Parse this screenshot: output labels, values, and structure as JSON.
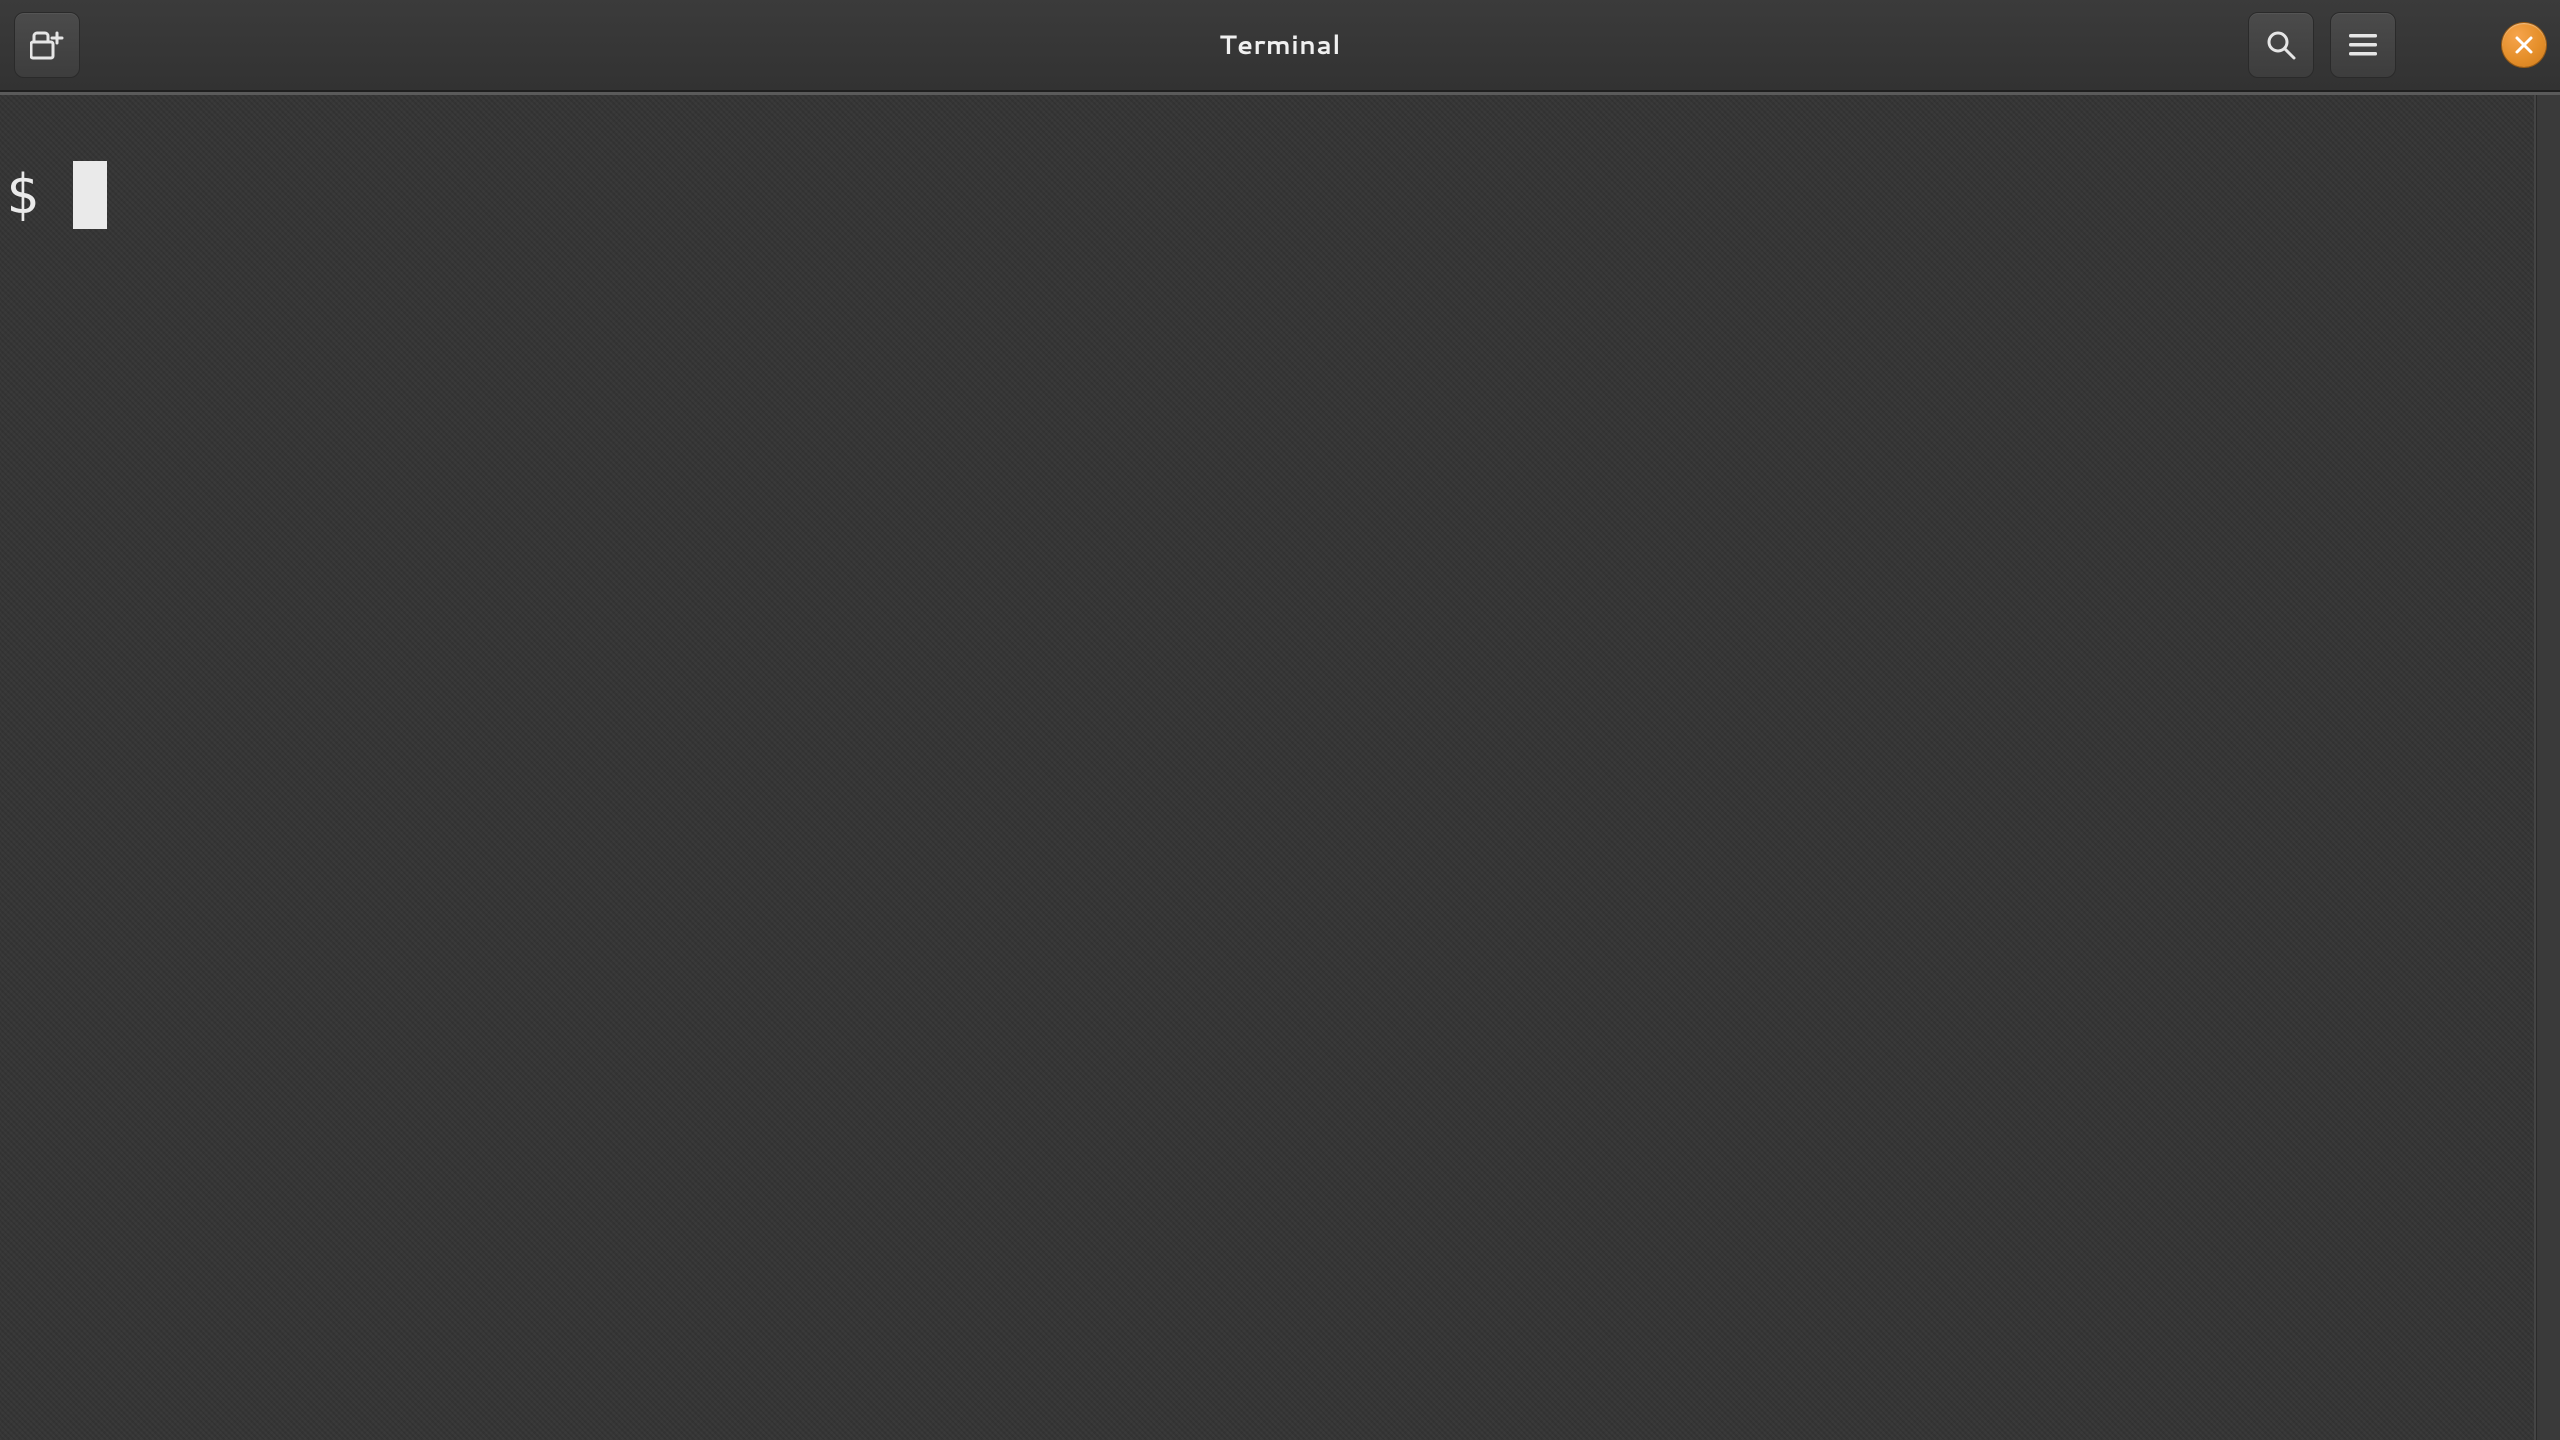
{
  "header": {
    "title": "Terminal",
    "new_tab_icon": "new-tab-icon",
    "search_icon": "search-icon",
    "menu_icon": "hamburger-menu-icon",
    "minimize_icon": "minimize-icon",
    "close_icon": "close-icon"
  },
  "terminal": {
    "prompt": "$",
    "input": ""
  },
  "colors": {
    "bg": "#333333",
    "header": "#353535",
    "text": "#eaeaea",
    "close_accent": "#e58f2a"
  }
}
